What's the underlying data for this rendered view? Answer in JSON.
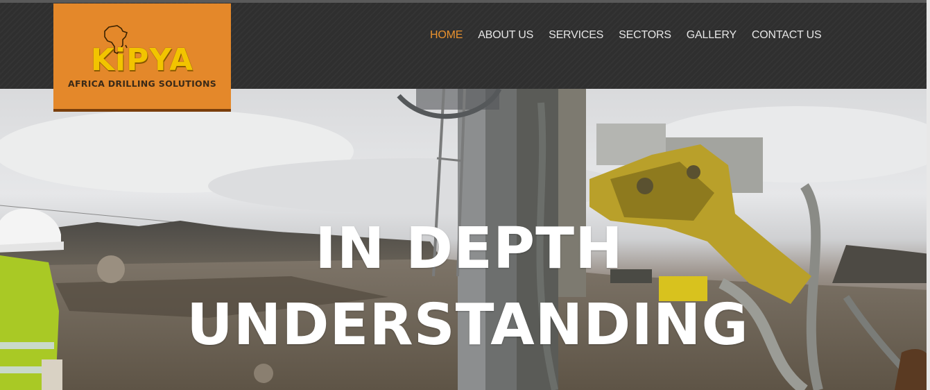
{
  "brand": {
    "name": "KiPYA",
    "tagline": "AFRICA DRILLING SOLUTIONS"
  },
  "nav": {
    "items": [
      {
        "label": "HOME",
        "active": true
      },
      {
        "label": "ABOUT US",
        "active": false
      },
      {
        "label": "SERVICES",
        "active": false
      },
      {
        "label": "SECTORS",
        "active": false
      },
      {
        "label": "GALLERY",
        "active": false
      },
      {
        "label": "CONTACT US",
        "active": false
      }
    ]
  },
  "hero": {
    "line1": "IN DEPTH",
    "line2": "UNDERSTANDING"
  },
  "colors": {
    "header_bg": "#2f2f2f",
    "logo_bg": "#e4882a",
    "logo_text": "#f2c400",
    "nav_active": "#e8912e",
    "nav_text": "#e6e6e6"
  }
}
